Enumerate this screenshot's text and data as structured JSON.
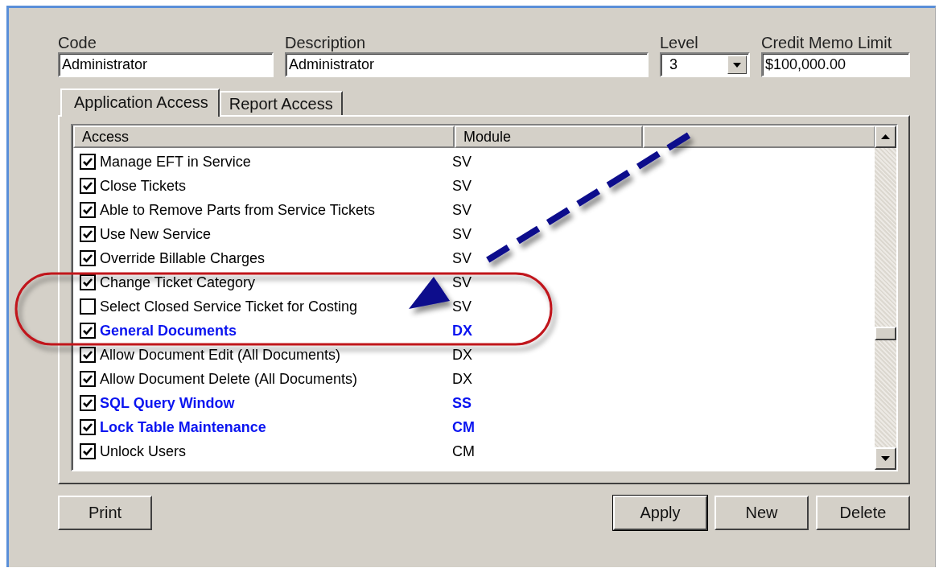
{
  "fields": [
    {
      "kind": "text",
      "label": "Code",
      "value": "Administrator"
    },
    {
      "kind": "text",
      "label": "Description",
      "value": "Administrator"
    },
    {
      "kind": "dropdown",
      "label": "Level",
      "value": "3"
    },
    {
      "kind": "text",
      "label": "Credit Memo Limit",
      "value": "$100,000.00"
    }
  ],
  "tabs": [
    {
      "label": "Application Access",
      "selected": true
    },
    {
      "label": "Report Access",
      "selected": false
    }
  ],
  "table": {
    "columns": [
      "Access",
      "Module"
    ],
    "rows": [
      {
        "kind": "item",
        "access": "Manage EFT in Service",
        "module": "SV",
        "checked": true
      },
      {
        "kind": "item",
        "access": "Close Tickets",
        "module": "SV",
        "checked": true
      },
      {
        "kind": "item",
        "access": "Able to Remove Parts from Service Tickets",
        "module": "SV",
        "checked": true
      },
      {
        "kind": "item",
        "access": "Use New Service",
        "module": "SV",
        "checked": true
      },
      {
        "kind": "item",
        "access": "Override Billable Charges",
        "module": "SV",
        "checked": true
      },
      {
        "kind": "item",
        "access": "Change Ticket Category",
        "module": "SV",
        "checked": true
      },
      {
        "kind": "item",
        "access": "Select Closed Service Ticket for Costing",
        "module": "SV",
        "checked": false
      },
      {
        "kind": "group",
        "access": "General Documents",
        "module": "DX",
        "checked": true
      },
      {
        "kind": "item",
        "access": "Allow Document Edit (All Documents)",
        "module": "DX",
        "checked": true
      },
      {
        "kind": "item",
        "access": "Allow Document Delete (All Documents)",
        "module": "DX",
        "checked": true
      },
      {
        "kind": "group",
        "access": "SQL Query Window",
        "module": "SS",
        "checked": true
      },
      {
        "kind": "group",
        "access": "Lock Table Maintenance",
        "module": "CM",
        "checked": true
      },
      {
        "kind": "item",
        "access": "Unlock Users",
        "module": "CM",
        "checked": true
      }
    ]
  },
  "buttons_left": [
    {
      "label": "Print",
      "default": false
    }
  ],
  "buttons_right": [
    {
      "label": "Apply",
      "default": true
    },
    {
      "label": "New",
      "default": false
    },
    {
      "label": "Delete",
      "default": false
    }
  ]
}
